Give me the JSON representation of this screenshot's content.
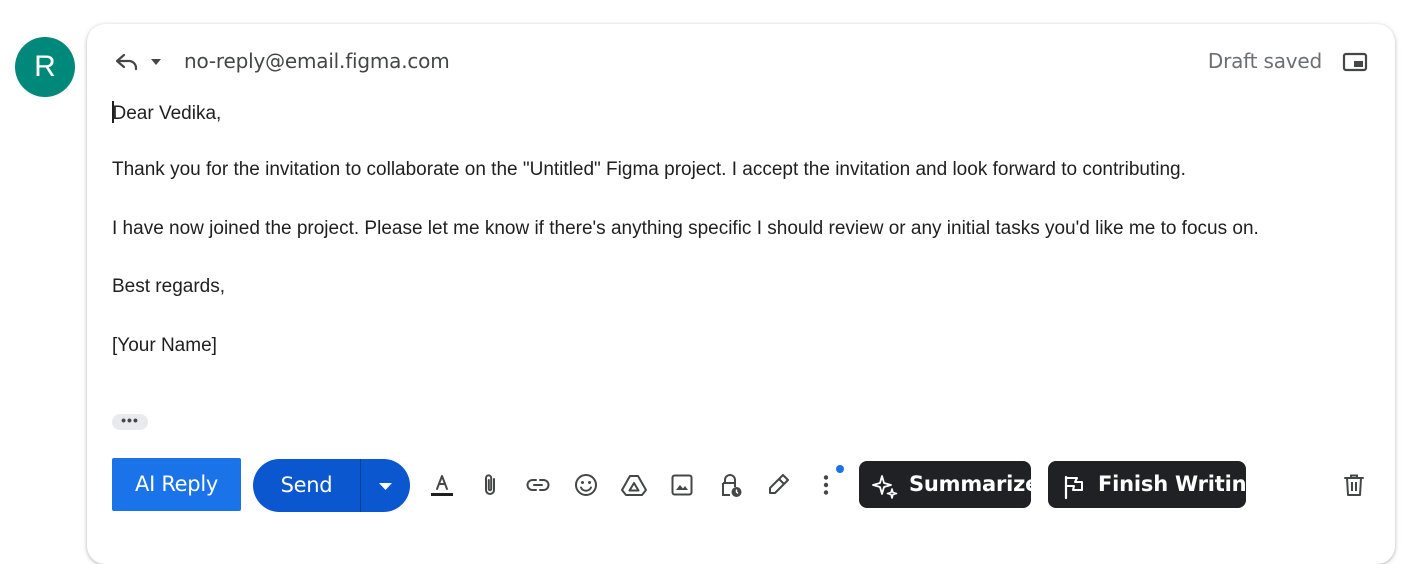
{
  "avatar": {
    "initial": "R",
    "color": "#00897b"
  },
  "header": {
    "recipient": "no-reply@email.figma.com",
    "status": "Draft saved",
    "icons": [
      "reply-icon",
      "chevron-down-icon",
      "pop-out-icon"
    ]
  },
  "body": {
    "greeting": "Dear Vedika,",
    "paragraph1": "Thank you for the invitation to collaborate on the \"Untitled\" Figma project. I accept the invitation and look forward to contributing.",
    "paragraph2": "I have now joined the project. Please let me know if there's anything specific I should review or any initial tasks you'd like me to focus on.",
    "closing": "Best regards,",
    "signature": "[Your Name]",
    "more_label": "•••"
  },
  "toolbar": {
    "ai_reply_label": "AI Reply",
    "send_label": "Send",
    "summarize_label": "Summarize",
    "finish_writing_label": "Finish Writing",
    "icons": [
      "text-format-icon",
      "attach-icon",
      "link-icon",
      "emoji-icon",
      "drive-icon",
      "photo-icon",
      "confidential-lock-icon",
      "signature-pen-icon",
      "more-options-icon",
      "sparkle-icon",
      "flag-icon",
      "trash-icon"
    ]
  },
  "colors": {
    "ai_reply": "#1a73e8",
    "send": "#0b57d0",
    "pill": "#202124",
    "notification_dot": "#1a73e8"
  }
}
